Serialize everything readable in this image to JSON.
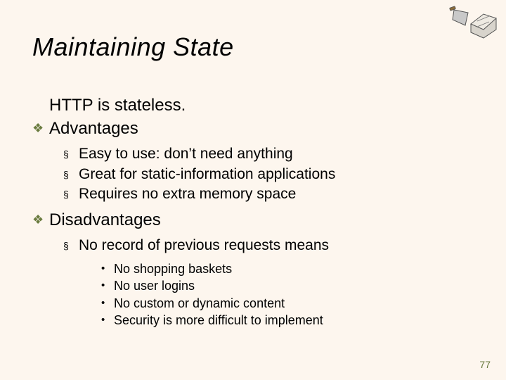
{
  "title": "Maintaining State",
  "intro": "HTTP is stateless.",
  "sections": {
    "advantages": {
      "heading": "Advantages",
      "items": [
        "Easy to use: don’t need anything",
        "Great for static-information applications",
        "Requires no extra memory space"
      ]
    },
    "disadvantages": {
      "heading": "Disadvantages",
      "lead": "No record of previous requests means",
      "items": [
        "No shopping baskets",
        "No user logins",
        "No custom or dynamic content",
        "Security is more difficult to implement"
      ]
    }
  },
  "page_number": "77",
  "bullets": {
    "l1": "❖",
    "l2": "§",
    "l3": "•"
  }
}
